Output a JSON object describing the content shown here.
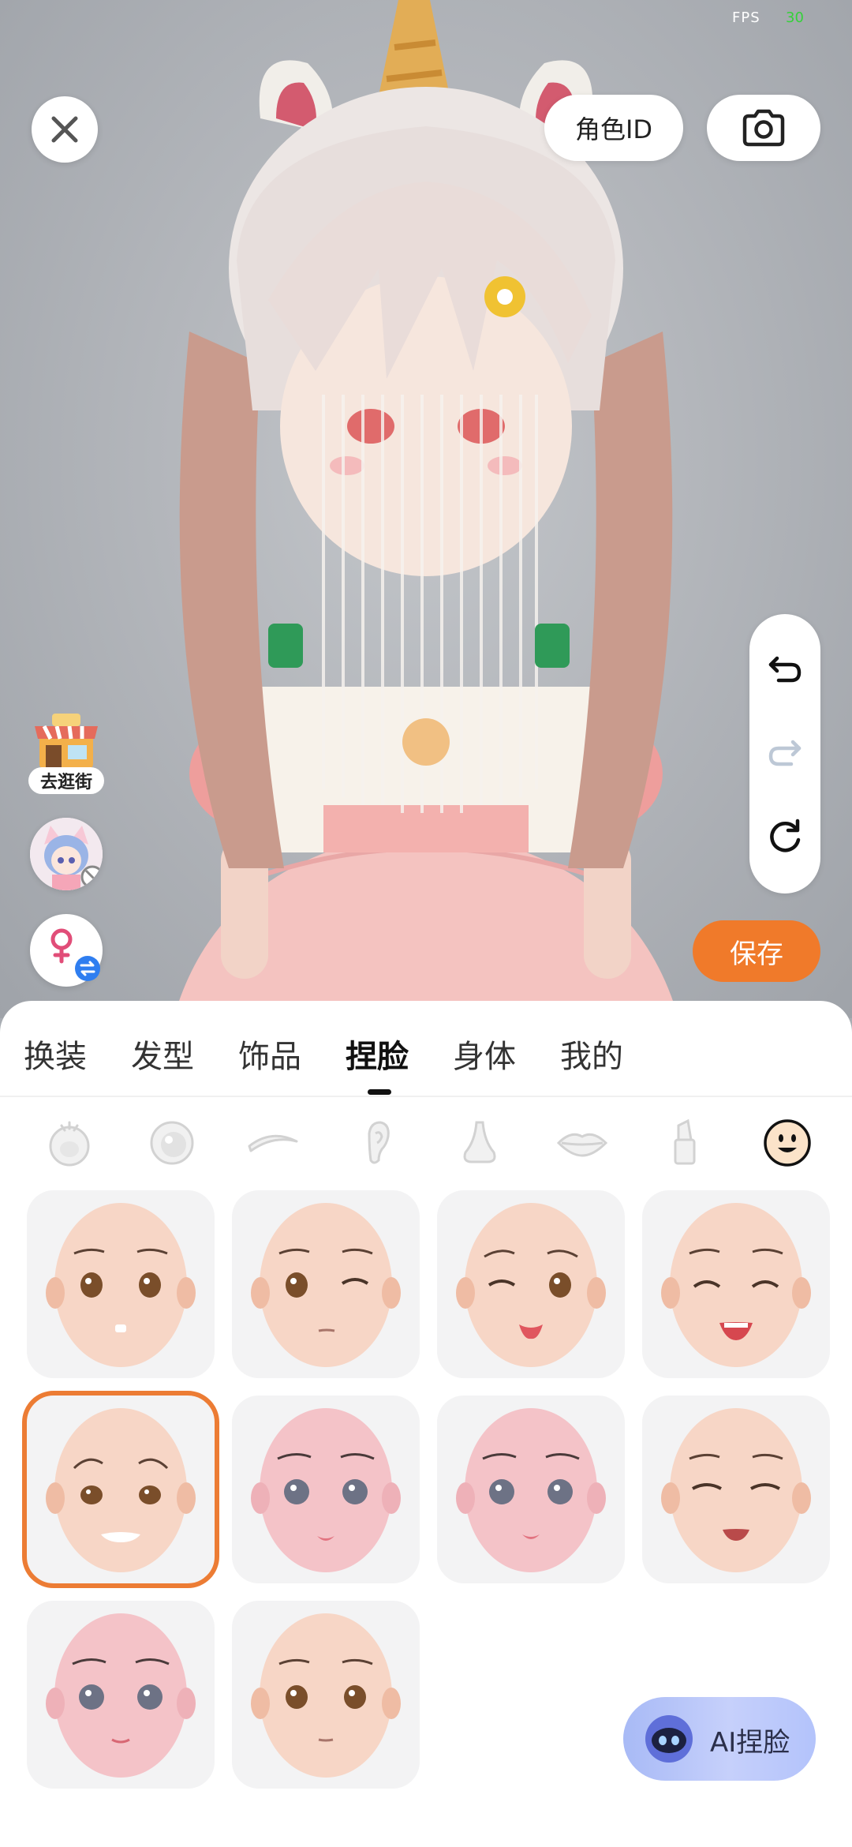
{
  "status": {
    "fps_label": "FPS",
    "fps_value": "30"
  },
  "header": {
    "role_id_label": "角色ID"
  },
  "side": {
    "shop_label": "去逛街"
  },
  "actions": {
    "save_label": "保存"
  },
  "tabs": [
    {
      "label": "换装",
      "active": false
    },
    {
      "label": "发型",
      "active": false
    },
    {
      "label": "饰品",
      "active": false
    },
    {
      "label": "捏脸",
      "active": true
    },
    {
      "label": "身体",
      "active": false
    },
    {
      "label": "我的",
      "active": false
    }
  ],
  "categories": [
    {
      "icon": "face-shape-icon"
    },
    {
      "icon": "eye-icon"
    },
    {
      "icon": "eyebrow-icon"
    },
    {
      "icon": "ear-icon"
    },
    {
      "icon": "nose-icon"
    },
    {
      "icon": "lips-icon"
    },
    {
      "icon": "lipstick-icon"
    },
    {
      "icon": "expression-icon",
      "active": true
    }
  ],
  "faces": [
    {
      "expression": "neutral",
      "selected": false
    },
    {
      "expression": "wink",
      "selected": false
    },
    {
      "expression": "tongue",
      "selected": false
    },
    {
      "expression": "smile-closed",
      "selected": false
    },
    {
      "expression": "worried",
      "selected": true
    },
    {
      "expression": "calm-pink",
      "selected": false
    },
    {
      "expression": "calm-pink-2",
      "selected": false
    },
    {
      "expression": "laugh-closed",
      "selected": false
    },
    {
      "expression": "calm-pink-3",
      "selected": false
    },
    {
      "expression": "plain",
      "selected": false
    }
  ],
  "ai_button": {
    "label": "AI捏脸"
  },
  "colors": {
    "accent": "#f07a2a",
    "selected_outline": "#ec7c34",
    "fps_green": "#35d13a"
  }
}
